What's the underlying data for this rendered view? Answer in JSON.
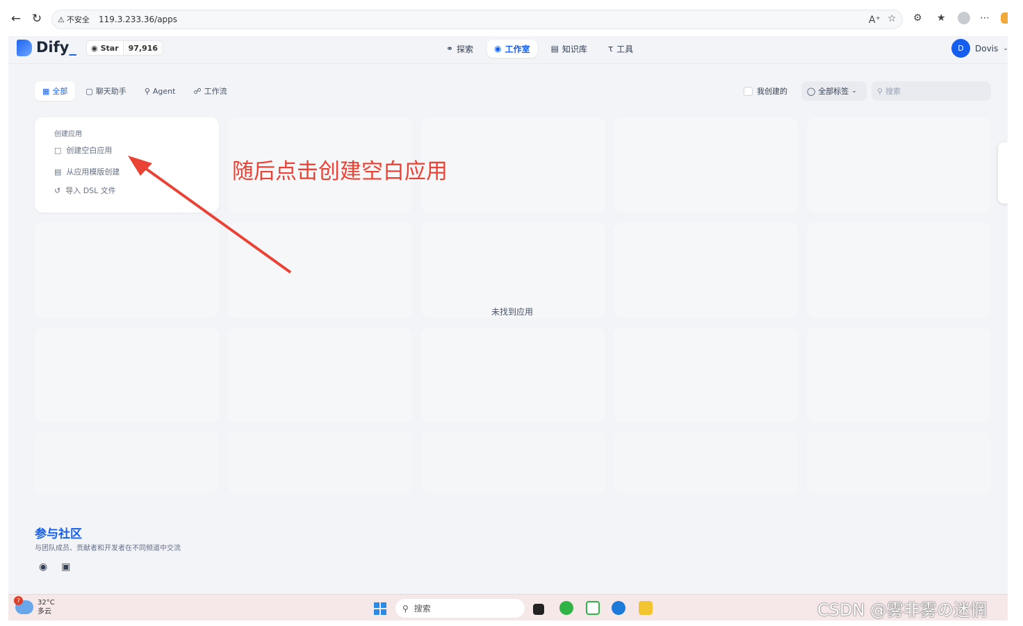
{
  "browser": {
    "security_label": "不安全",
    "url": "119.3.233.36/apps"
  },
  "header": {
    "logo_text": "Dify",
    "github_star_label": "Star",
    "github_star_count": "97,916",
    "nav": [
      {
        "label": "探索",
        "active": false
      },
      {
        "label": "工作室",
        "active": true
      },
      {
        "label": "知识库",
        "active": false
      },
      {
        "label": "工具",
        "active": false
      }
    ],
    "user_initial": "D",
    "user_name": "Dovis"
  },
  "filters": {
    "tabs": [
      {
        "label": "全部",
        "active": true
      },
      {
        "label": "聊天助手",
        "active": false
      },
      {
        "label": "Agent",
        "active": false
      },
      {
        "label": "工作流",
        "active": false
      }
    ],
    "mine_label": "我创建的",
    "tag_label": "全部标签",
    "search_placeholder": "搜索"
  },
  "create_card": {
    "title": "创建应用",
    "items": [
      "创建空白应用",
      "从应用模版创建",
      "导入 DSL 文件"
    ]
  },
  "empty_message": "未找到应用",
  "annotation": "随后点击创建空白应用",
  "community": {
    "title": "参与社区",
    "subtitle": "与团队成员、贡献者和开发者在不同频道中交流"
  },
  "taskbar": {
    "weather_temp": "32°C",
    "weather_desc": "多云",
    "weather_badge": "7",
    "search_label": "搜索"
  },
  "watermark": "CSDN @雾非雾の迷惘",
  "colors": {
    "accent": "#155eef",
    "annotation": "#ea4335"
  }
}
